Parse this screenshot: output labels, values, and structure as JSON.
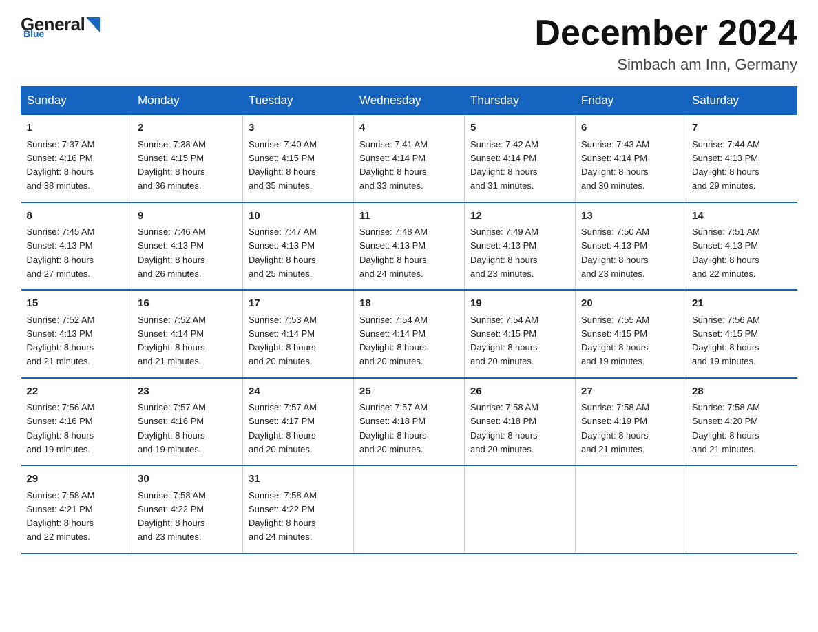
{
  "logo": {
    "general": "General",
    "blue": "Blue",
    "sub": "Blue"
  },
  "header": {
    "month": "December 2024",
    "location": "Simbach am Inn, Germany"
  },
  "days_of_week": [
    "Sunday",
    "Monday",
    "Tuesday",
    "Wednesday",
    "Thursday",
    "Friday",
    "Saturday"
  ],
  "weeks": [
    [
      {
        "day": "1",
        "sunrise": "7:37 AM",
        "sunset": "4:16 PM",
        "daylight": "8 hours and 38 minutes."
      },
      {
        "day": "2",
        "sunrise": "7:38 AM",
        "sunset": "4:15 PM",
        "daylight": "8 hours and 36 minutes."
      },
      {
        "day": "3",
        "sunrise": "7:40 AM",
        "sunset": "4:15 PM",
        "daylight": "8 hours and 35 minutes."
      },
      {
        "day": "4",
        "sunrise": "7:41 AM",
        "sunset": "4:14 PM",
        "daylight": "8 hours and 33 minutes."
      },
      {
        "day": "5",
        "sunrise": "7:42 AM",
        "sunset": "4:14 PM",
        "daylight": "8 hours and 31 minutes."
      },
      {
        "day": "6",
        "sunrise": "7:43 AM",
        "sunset": "4:14 PM",
        "daylight": "8 hours and 30 minutes."
      },
      {
        "day": "7",
        "sunrise": "7:44 AM",
        "sunset": "4:13 PM",
        "daylight": "8 hours and 29 minutes."
      }
    ],
    [
      {
        "day": "8",
        "sunrise": "7:45 AM",
        "sunset": "4:13 PM",
        "daylight": "8 hours and 27 minutes."
      },
      {
        "day": "9",
        "sunrise": "7:46 AM",
        "sunset": "4:13 PM",
        "daylight": "8 hours and 26 minutes."
      },
      {
        "day": "10",
        "sunrise": "7:47 AM",
        "sunset": "4:13 PM",
        "daylight": "8 hours and 25 minutes."
      },
      {
        "day": "11",
        "sunrise": "7:48 AM",
        "sunset": "4:13 PM",
        "daylight": "8 hours and 24 minutes."
      },
      {
        "day": "12",
        "sunrise": "7:49 AM",
        "sunset": "4:13 PM",
        "daylight": "8 hours and 23 minutes."
      },
      {
        "day": "13",
        "sunrise": "7:50 AM",
        "sunset": "4:13 PM",
        "daylight": "8 hours and 23 minutes."
      },
      {
        "day": "14",
        "sunrise": "7:51 AM",
        "sunset": "4:13 PM",
        "daylight": "8 hours and 22 minutes."
      }
    ],
    [
      {
        "day": "15",
        "sunrise": "7:52 AM",
        "sunset": "4:13 PM",
        "daylight": "8 hours and 21 minutes."
      },
      {
        "day": "16",
        "sunrise": "7:52 AM",
        "sunset": "4:14 PM",
        "daylight": "8 hours and 21 minutes."
      },
      {
        "day": "17",
        "sunrise": "7:53 AM",
        "sunset": "4:14 PM",
        "daylight": "8 hours and 20 minutes."
      },
      {
        "day": "18",
        "sunrise": "7:54 AM",
        "sunset": "4:14 PM",
        "daylight": "8 hours and 20 minutes."
      },
      {
        "day": "19",
        "sunrise": "7:54 AM",
        "sunset": "4:15 PM",
        "daylight": "8 hours and 20 minutes."
      },
      {
        "day": "20",
        "sunrise": "7:55 AM",
        "sunset": "4:15 PM",
        "daylight": "8 hours and 19 minutes."
      },
      {
        "day": "21",
        "sunrise": "7:56 AM",
        "sunset": "4:15 PM",
        "daylight": "8 hours and 19 minutes."
      }
    ],
    [
      {
        "day": "22",
        "sunrise": "7:56 AM",
        "sunset": "4:16 PM",
        "daylight": "8 hours and 19 minutes."
      },
      {
        "day": "23",
        "sunrise": "7:57 AM",
        "sunset": "4:16 PM",
        "daylight": "8 hours and 19 minutes."
      },
      {
        "day": "24",
        "sunrise": "7:57 AM",
        "sunset": "4:17 PM",
        "daylight": "8 hours and 20 minutes."
      },
      {
        "day": "25",
        "sunrise": "7:57 AM",
        "sunset": "4:18 PM",
        "daylight": "8 hours and 20 minutes."
      },
      {
        "day": "26",
        "sunrise": "7:58 AM",
        "sunset": "4:18 PM",
        "daylight": "8 hours and 20 minutes."
      },
      {
        "day": "27",
        "sunrise": "7:58 AM",
        "sunset": "4:19 PM",
        "daylight": "8 hours and 21 minutes."
      },
      {
        "day": "28",
        "sunrise": "7:58 AM",
        "sunset": "4:20 PM",
        "daylight": "8 hours and 21 minutes."
      }
    ],
    [
      {
        "day": "29",
        "sunrise": "7:58 AM",
        "sunset": "4:21 PM",
        "daylight": "8 hours and 22 minutes."
      },
      {
        "day": "30",
        "sunrise": "7:58 AM",
        "sunset": "4:22 PM",
        "daylight": "8 hours and 23 minutes."
      },
      {
        "day": "31",
        "sunrise": "7:58 AM",
        "sunset": "4:22 PM",
        "daylight": "8 hours and 24 minutes."
      },
      null,
      null,
      null,
      null
    ]
  ],
  "labels": {
    "sunrise": "Sunrise:",
    "sunset": "Sunset:",
    "daylight": "Daylight:"
  }
}
